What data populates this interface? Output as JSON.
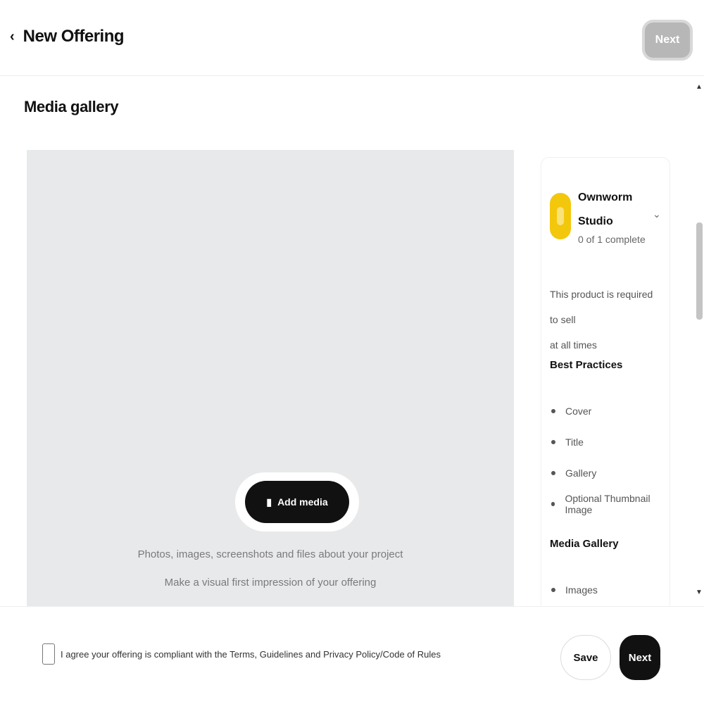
{
  "header": {
    "title": "New Offering",
    "next_label": "Next"
  },
  "main": {
    "section_title": "Media gallery",
    "upload": {
      "button_label": "Add media",
      "line1": "Photos, images, screenshots and files about your project",
      "line2": "Make a visual first impression of your offering"
    }
  },
  "sidebar": {
    "seller_name_1": "Ownworm",
    "seller_name_2": "Studio",
    "seller_sub": "0 of 1 complete",
    "note_line1": "This product is required to sell",
    "note_line2": "at all times",
    "tips_title": "Best Practices",
    "tips": [
      {
        "label": "Cover"
      },
      {
        "label": "Title"
      },
      {
        "label": "Gallery"
      },
      {
        "label": "Optional Thumbnail Image"
      }
    ],
    "media_title": "Media Gallery",
    "media_items": [
      {
        "label": "Images"
      }
    ]
  },
  "footer": {
    "terms_text": "I agree your offering is compliant with the Terms, Guidelines and Privacy Policy/Code of Rules",
    "save_label": "Save",
    "publish_label": "Next"
  }
}
